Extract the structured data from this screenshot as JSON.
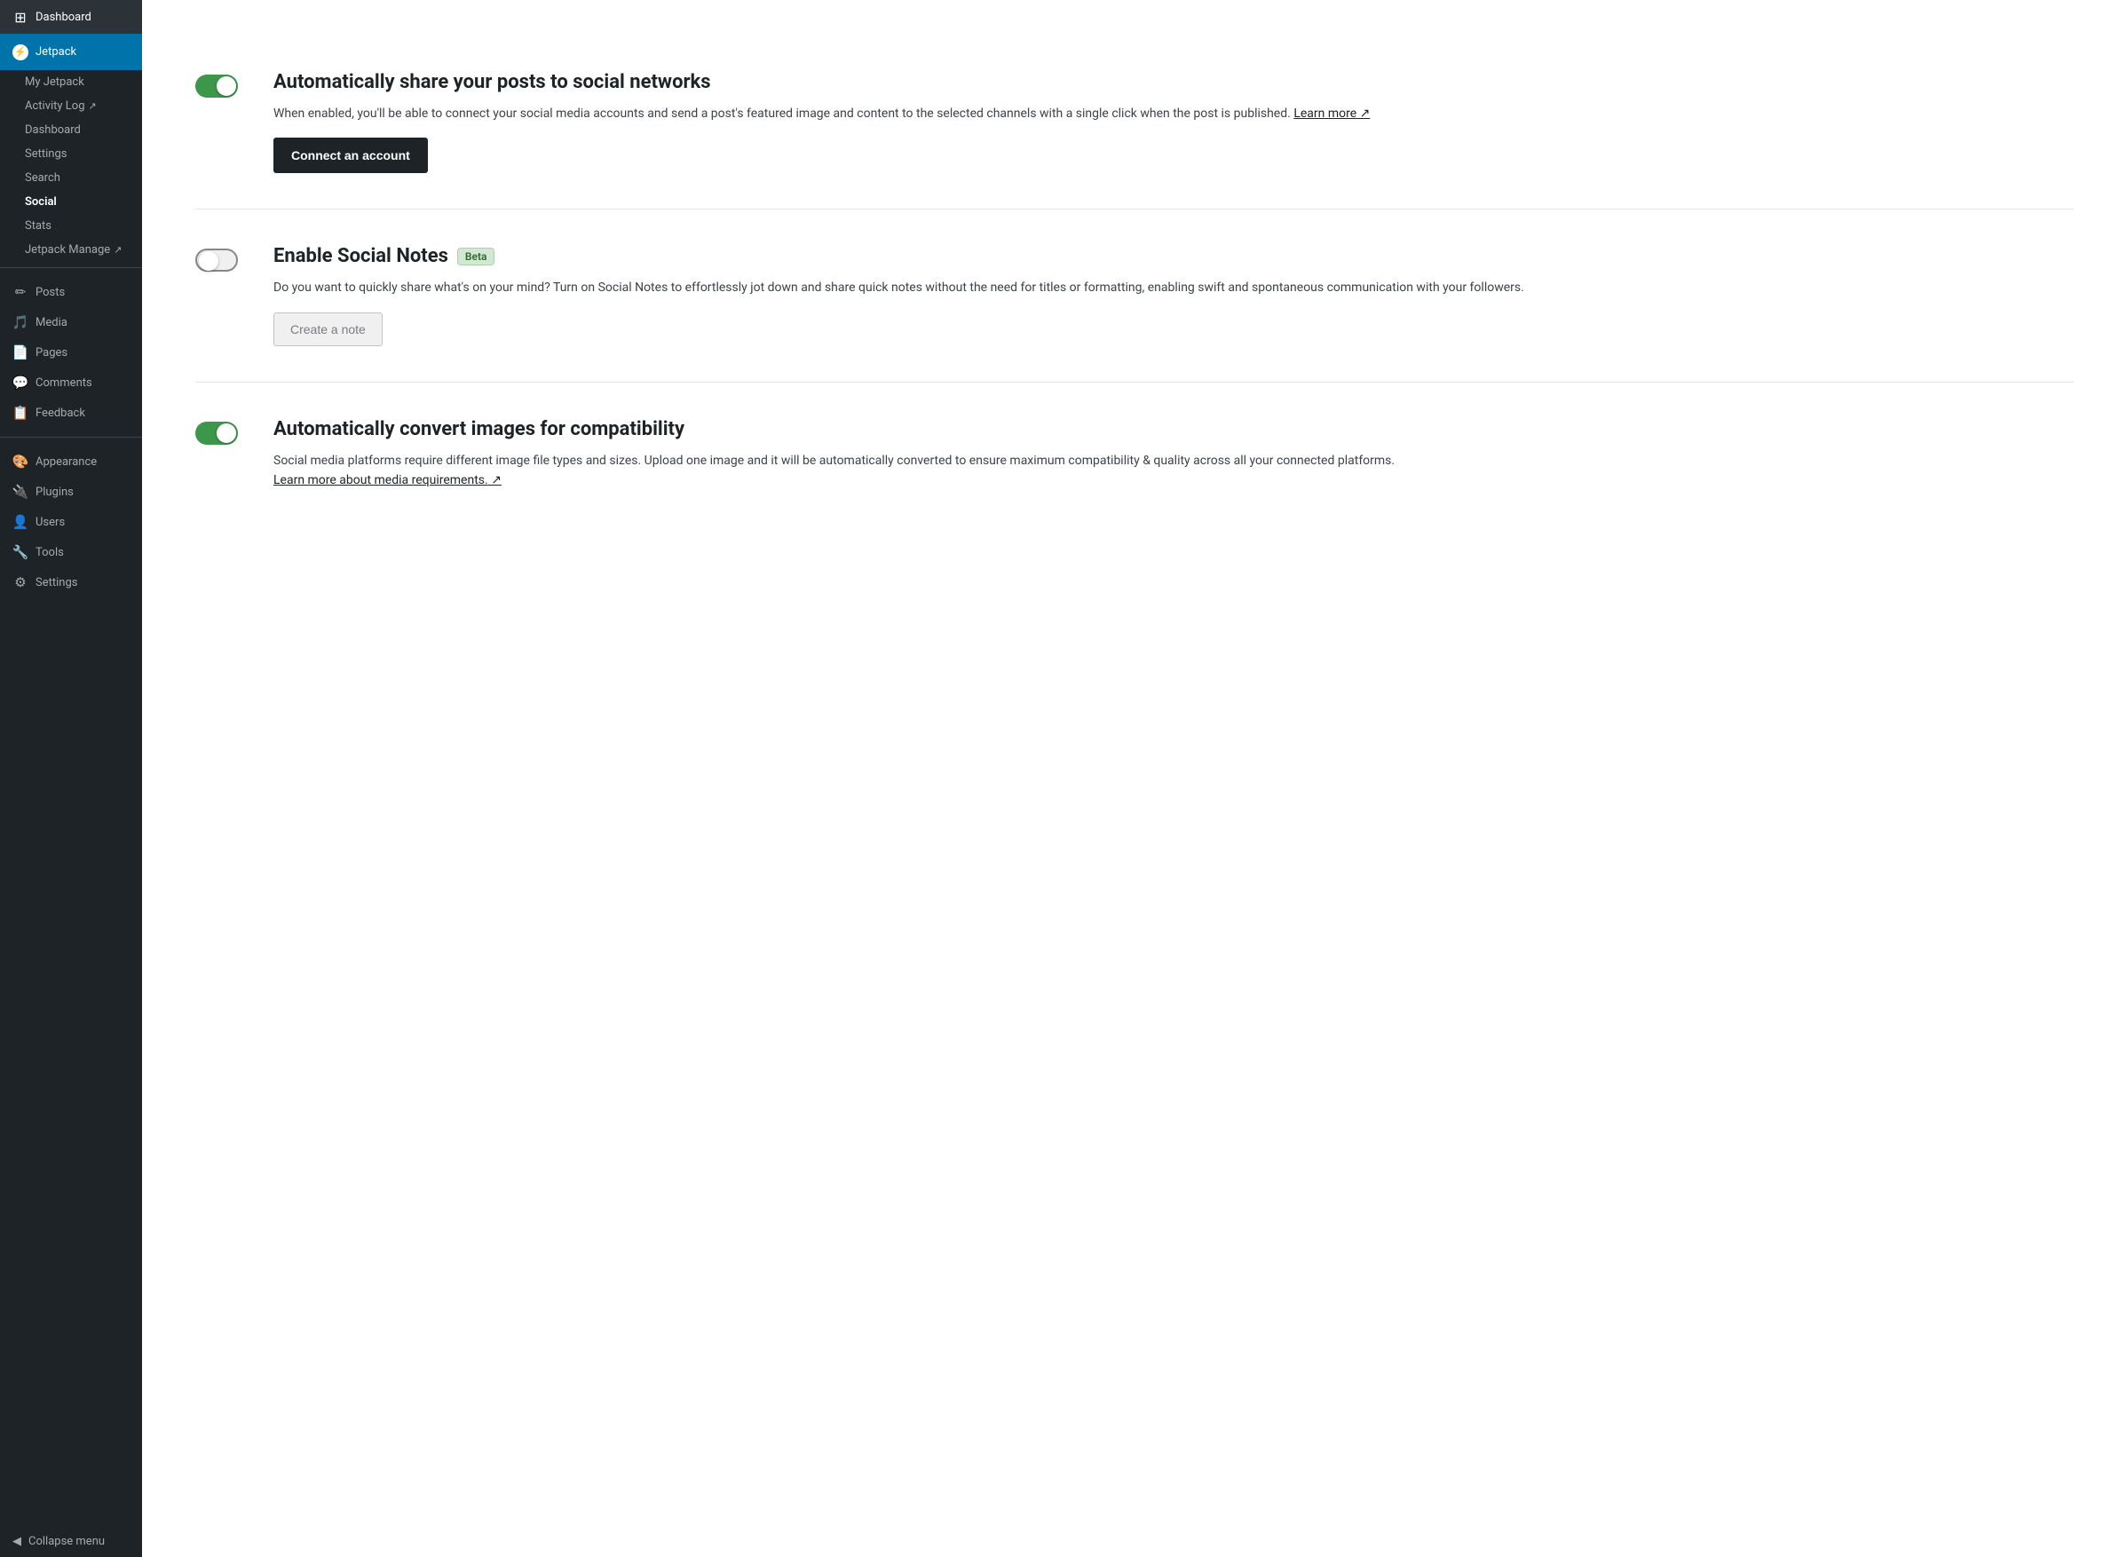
{
  "sidebar": {
    "dashboard_label": "Dashboard",
    "jetpack_label": "Jetpack",
    "sub_items": [
      {
        "label": "My Jetpack",
        "active": false,
        "external": false
      },
      {
        "label": "Activity Log",
        "active": false,
        "external": true
      },
      {
        "label": "Dashboard",
        "active": false,
        "external": false
      },
      {
        "label": "Settings",
        "active": false,
        "external": false
      },
      {
        "label": "Search",
        "active": false,
        "external": false
      },
      {
        "label": "Social",
        "active": true,
        "external": false
      },
      {
        "label": "Stats",
        "active": false,
        "external": false
      },
      {
        "label": "Jetpack Manage",
        "active": false,
        "external": true
      }
    ],
    "main_items": [
      {
        "label": "Posts",
        "icon": "✏"
      },
      {
        "label": "Media",
        "icon": "🎵"
      },
      {
        "label": "Pages",
        "icon": "📄"
      },
      {
        "label": "Comments",
        "icon": "💬"
      },
      {
        "label": "Feedback",
        "icon": "📋"
      },
      {
        "label": "Appearance",
        "icon": "🎨"
      },
      {
        "label": "Plugins",
        "icon": "🔌"
      },
      {
        "label": "Users",
        "icon": "👤"
      },
      {
        "label": "Tools",
        "icon": "🔧"
      },
      {
        "label": "Settings",
        "icon": "⚙"
      }
    ],
    "collapse_label": "Collapse menu"
  },
  "features": [
    {
      "id": "auto-share",
      "toggle_on": true,
      "title": "Automatically share your posts to social networks",
      "description": "When enabled, you'll be able to connect your social media accounts and send a post's featured image and content to the selected channels with a single click when the post is published.",
      "learn_more_text": "Learn more",
      "learn_more_show": true,
      "button_label": "Connect an account",
      "button_type": "primary",
      "beta": false
    },
    {
      "id": "social-notes",
      "toggle_on": false,
      "title": "Enable Social Notes",
      "beta_label": "Beta",
      "description": "Do you want to quickly share what's on your mind? Turn on Social Notes to effortlessly jot down and share quick notes without the need for titles or formatting, enabling swift and spontaneous communication with your followers.",
      "learn_more_show": false,
      "button_label": "Create a note",
      "button_type": "secondary",
      "beta": true
    },
    {
      "id": "auto-convert",
      "toggle_on": true,
      "title": "Automatically convert images for compatibility",
      "description": "Social media platforms require different image file types and sizes. Upload one image and it will be automatically converted to ensure maximum compatibility & quality across all your connected platforms.",
      "learn_more_text": "Learn more about media requirements.",
      "learn_more_show": true,
      "button_label": "",
      "button_type": "none",
      "beta": false
    }
  ]
}
